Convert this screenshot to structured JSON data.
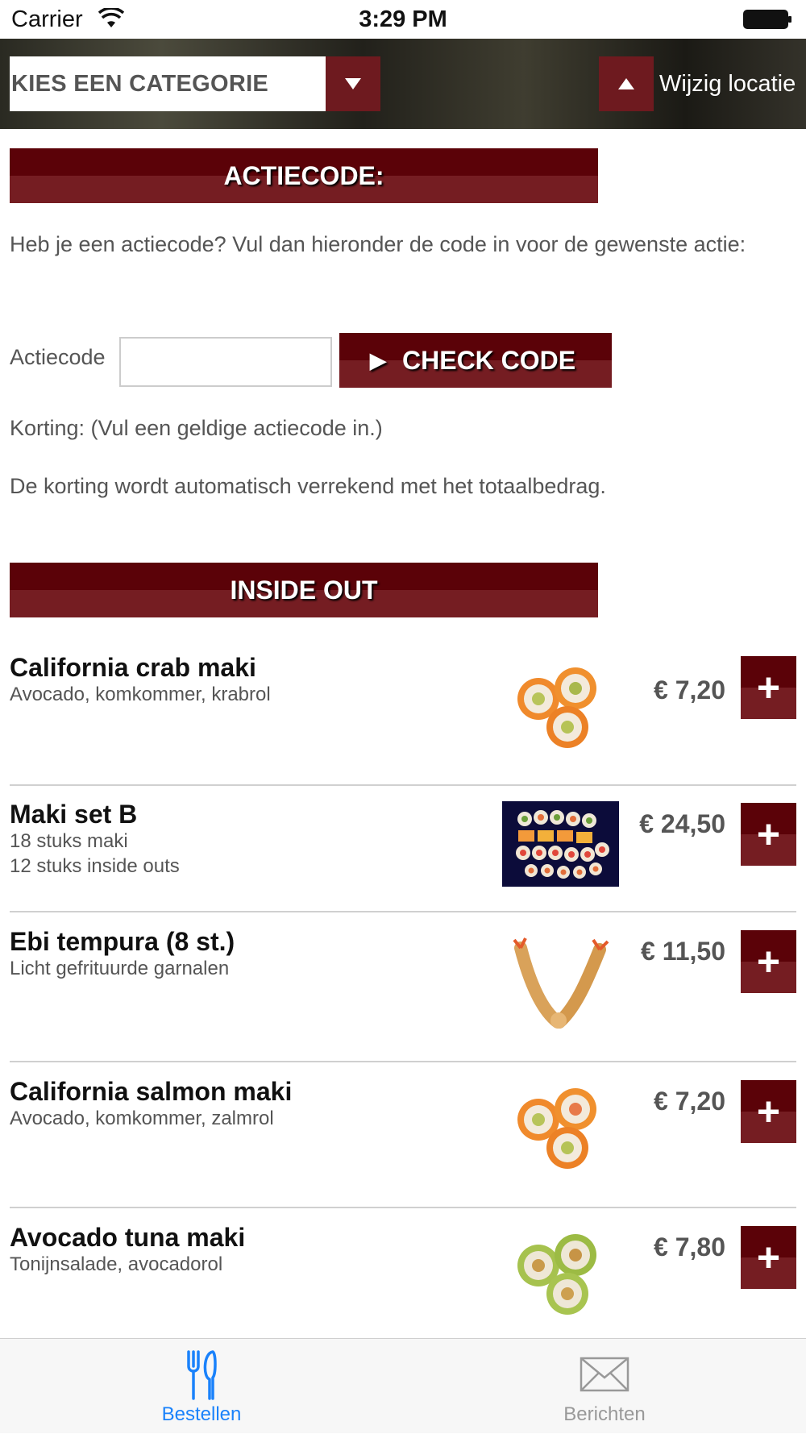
{
  "status_bar": {
    "carrier": "Carrier",
    "time": "3:29 PM"
  },
  "header": {
    "category_select": {
      "label": "KIES EEN CATEGORIE",
      "icon": "triangle-down-icon"
    },
    "location_button": {
      "label": "Wijzig locatie",
      "icon": "triangle-up-icon"
    }
  },
  "promo": {
    "title": "ACTIECODE:",
    "intro": "Heb je een actiecode? Vul dan hieronder de code in voor de gewenste actie:",
    "code_label": "Actiecode",
    "code_value": "",
    "check_button": "CHECK CODE",
    "discount": "Korting: (Vul een geldige actiecode in.)",
    "note": "De korting wordt automatisch verrekend met het totaalbedrag."
  },
  "section": {
    "title": "INSIDE OUT"
  },
  "items": [
    {
      "name": "California crab maki",
      "desc": [
        "Avocado, komkommer, krabrol"
      ],
      "price": "€ 7,20",
      "image": "sushi-roll-orange"
    },
    {
      "name": "Maki set B",
      "desc": [
        "18 stuks maki",
        "12 stuks inside outs"
      ],
      "price": "€ 24,50",
      "image": "maki-set-platter"
    },
    {
      "name": "Ebi tempura (8 st.)",
      "desc": [
        "Licht gefrituurde garnalen"
      ],
      "price": "€ 11,50",
      "image": "tempura-shrimp"
    },
    {
      "name": "California salmon maki",
      "desc": [
        "Avocado, komkommer, zalmrol"
      ],
      "price": "€ 7,20",
      "image": "sushi-roll-orange"
    },
    {
      "name": "Avocado tuna maki",
      "desc": [
        "Tonijnsalade, avocadorol"
      ],
      "price": "€ 7,80",
      "image": "sushi-roll-green"
    }
  ],
  "add_button_label": "+",
  "tabbar": {
    "tabs": [
      {
        "label": "Bestellen",
        "icon": "fork-knife-icon",
        "active": true
      },
      {
        "label": "Berichten",
        "icon": "envelope-icon",
        "active": false
      }
    ]
  },
  "colors": {
    "accent": "#6e1a1f",
    "bar_dark": "#5b0208",
    "tab_active": "#1a82fb",
    "tab_inactive": "#999999"
  }
}
